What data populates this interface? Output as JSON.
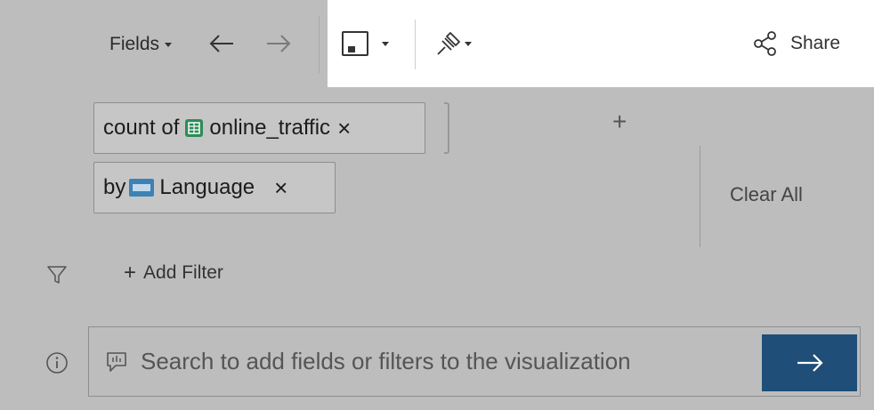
{
  "toolbar": {
    "fields_label": "Fields",
    "share_label": "Share"
  },
  "pills": {
    "measure": {
      "prefix": "count of",
      "field": "online_traffic",
      "close": "×"
    },
    "dimension": {
      "prefix": "by",
      "field": "Language",
      "close": "×"
    }
  },
  "actions": {
    "add_plus": "+",
    "clear_all": "Clear All"
  },
  "filter": {
    "add_plus": "+",
    "add_filter_label": "Add Filter"
  },
  "search": {
    "placeholder": "Search to add fields or filters to the visualization"
  },
  "icons": {
    "measure_field": "table-icon",
    "dimension_field": "abc-icon",
    "share": "share-nodes-icon",
    "save": "save-icon",
    "pin": "pin-icon",
    "filter": "funnel-icon",
    "info": "info-icon",
    "search_bubble": "speech-bubble-icon",
    "go": "arrow-right-icon"
  },
  "colors": {
    "background": "#bdbdbd",
    "toolbar_highlight": "#ffffff",
    "go_button": "#1f4e79",
    "measure_icon": "#2e8b57",
    "dimension_icon": "#3c82b4"
  }
}
